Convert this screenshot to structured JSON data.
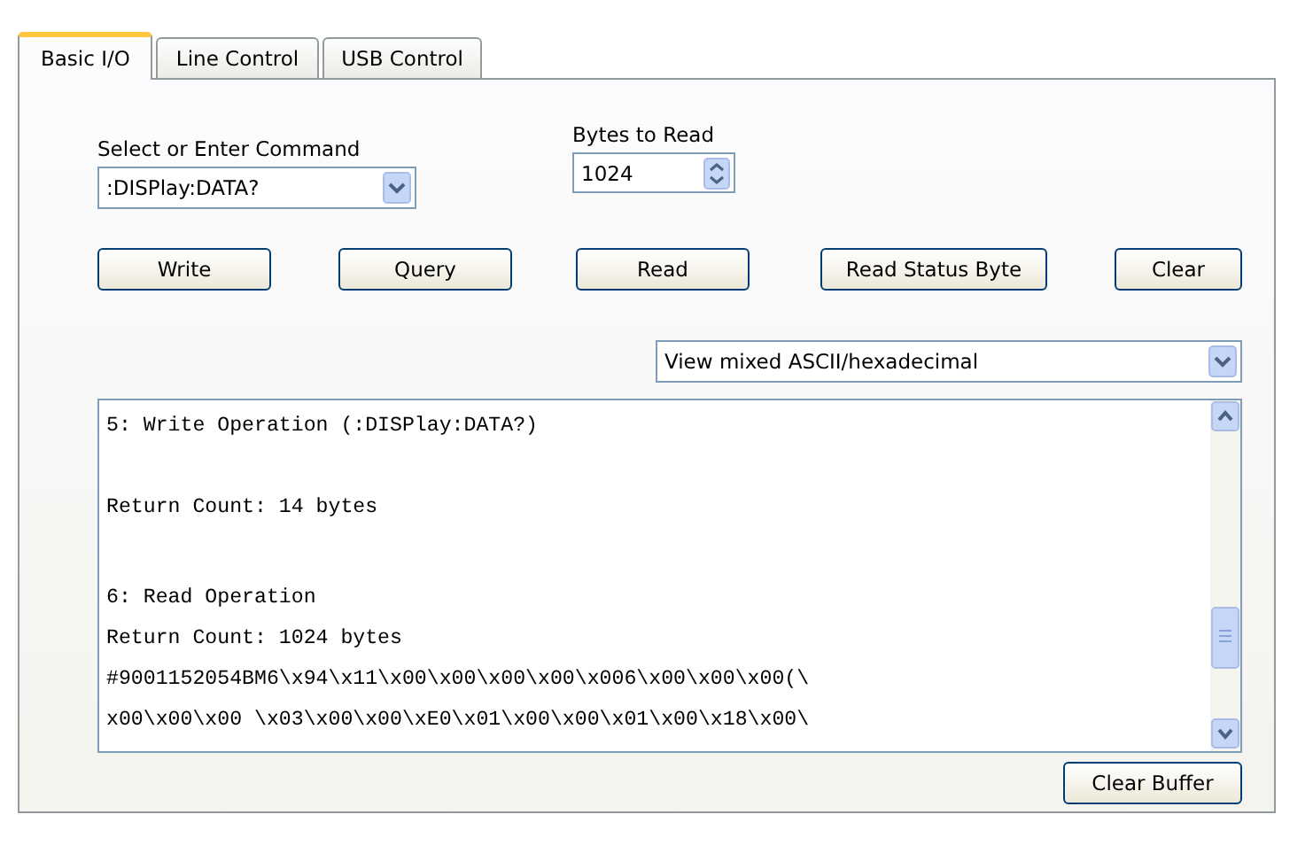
{
  "tabs": [
    {
      "label": "Basic I/O",
      "selected": true
    },
    {
      "label": "Line Control",
      "selected": false
    },
    {
      "label": "USB Control",
      "selected": false
    }
  ],
  "command": {
    "label": "Select or Enter Command",
    "value": ":DISPlay:DATA?"
  },
  "bytes_to_read": {
    "label": "Bytes to Read",
    "value": "1024"
  },
  "buttons": [
    "Write",
    "Query",
    "Read",
    "Read Status Byte",
    "Clear"
  ],
  "view_mode": {
    "value": "View mixed ASCII/hexadecimal"
  },
  "output": [
    {
      "lines": [
        "5: Write Operation (:DISPlay:DATA?)"
      ]
    },
    {
      "lines": [
        "Return Count: 14 bytes"
      ]
    },
    {
      "lines": [
        "6: Read Operation",
        "Return Count: 1024 bytes",
        "#9001152054BM6\\x94\\x11\\x00\\x00\\x00\\x00\\x006\\x00\\x00\\x00(\\",
        "x00\\x00\\x00 \\x03\\x00\\x00\\xE0\\x01\\x00\\x00\\x01\\x00\\x18\\x00\\"
      ]
    }
  ],
  "clear_buffer": "Clear Buffer"
}
